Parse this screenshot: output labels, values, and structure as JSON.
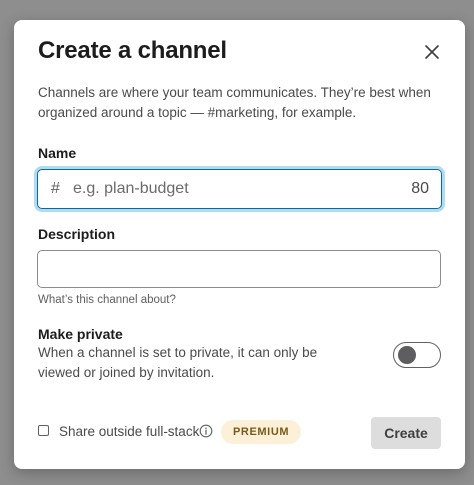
{
  "dialog": {
    "title": "Create a channel",
    "intro": "Channels are where your team communicates. They’re best when organized around a topic — #marketing, for example."
  },
  "name_field": {
    "label": "Name",
    "prefix": "#",
    "placeholder": "e.g. plan-budget",
    "value": "",
    "remaining_chars": "80"
  },
  "description_field": {
    "label": "Description",
    "value": "",
    "hint": "What’s this channel about?"
  },
  "private_setting": {
    "label": "Make private",
    "description": "When a channel is set to private, it can only be viewed or joined by invitation.",
    "enabled": false
  },
  "footer": {
    "share_label": "Share outside full-stack",
    "share_checked": false,
    "premium_badge": "PREMIUM",
    "create_label": "Create"
  },
  "icons": {
    "close": "close-icon",
    "info": "info-icon"
  },
  "colors": {
    "focus_border": "#1264a3",
    "premium_bg": "#fcf1d8",
    "disabled_button": "#dddddd"
  }
}
